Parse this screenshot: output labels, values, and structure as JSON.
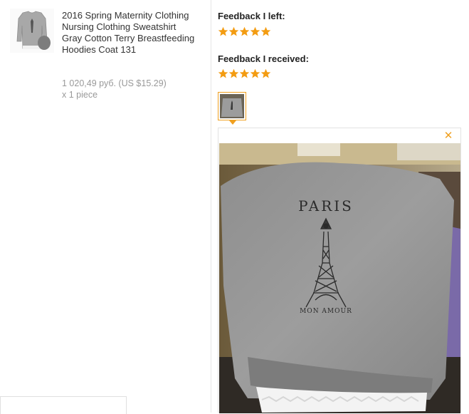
{
  "product": {
    "title": "2016 Spring Maternity Clothing Nursing Clothing Sweatshirt Gray Cotton Terry Breastfeeding Hoodies Coat 131",
    "price": "1 020,49 руб. (US $15.29)",
    "quantity": "x 1 piece",
    "thumbnail_icon": "sweatshirt-thumbnail"
  },
  "feedback": {
    "left_label": "Feedback I left:",
    "left_rating": 5,
    "received_label": "Feedback I received:",
    "received_rating": 5,
    "star_color": "#f39c12"
  },
  "viewer": {
    "close_icon": "close-icon",
    "accent_color": "#f0a020",
    "photo_text_top": "PARIS",
    "photo_text_bottom": "MON AMOUR"
  }
}
